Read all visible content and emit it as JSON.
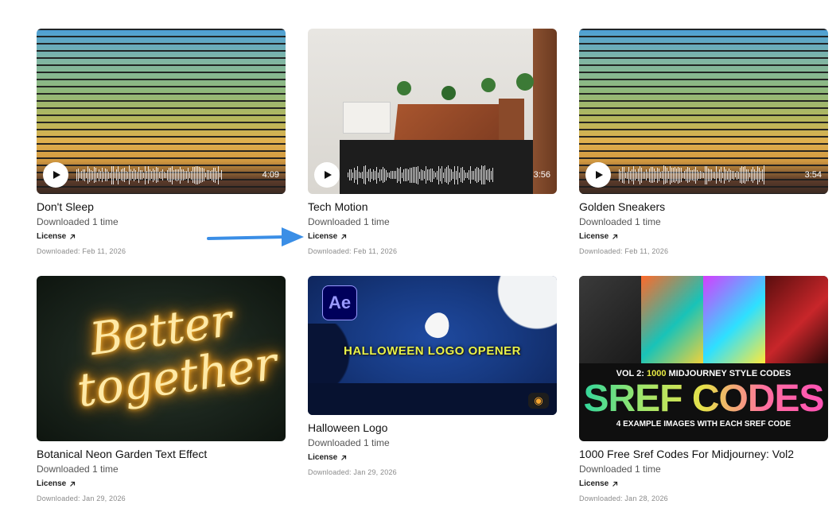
{
  "cards": [
    {
      "title": "Don't Sleep",
      "sub": "Downloaded 1 time",
      "license": "License",
      "date": "Downloaded: Feb 11, 2026",
      "duration": "4:09"
    },
    {
      "title": "Tech Motion",
      "sub": "Downloaded 1 time",
      "license": "License",
      "date": "Downloaded: Feb 11, 2026",
      "duration": "3:56"
    },
    {
      "title": "Golden Sneakers",
      "sub": "Downloaded 1 time",
      "license": "License",
      "date": "Downloaded: Feb 11, 2026",
      "duration": "3:54"
    },
    {
      "title": "Botanical Neon Garden Text Effect",
      "sub": "Downloaded 1 time",
      "license": "License",
      "date": "Downloaded: Jan 29, 2026",
      "thumb_text": [
        "Better",
        "together"
      ]
    },
    {
      "title": "Halloween Logo",
      "sub": "Downloaded 1 time",
      "license": "License",
      "date": "Downloaded: Jan 29, 2026",
      "badge": "Ae",
      "thumb_text": "HALLOWEEN LOGO OPENER"
    },
    {
      "title": "1000 Free Sref Codes For Midjourney: Vol2",
      "sub": "Downloaded 1 time",
      "license": "License",
      "date": "Downloaded: Jan 28, 2026",
      "thumb_caption_prefix": "VOL 2:",
      "thumb_caption_highlight": "1000",
      "thumb_caption_suffix": "MIDJOURNEY STYLE CODES",
      "thumb_big": "SREF CODES",
      "thumb_caption2": "4 EXAMPLE IMAGES WITH EACH SREF CODE"
    }
  ],
  "icons": {
    "play": "play-icon",
    "external": "external-link-icon",
    "arrow": "arrow-annotation"
  },
  "colors": {
    "annotation_arrow": "#3a8ee6",
    "ae_badge_bg": "#00005b",
    "ae_badge_fg": "#9999ff"
  }
}
